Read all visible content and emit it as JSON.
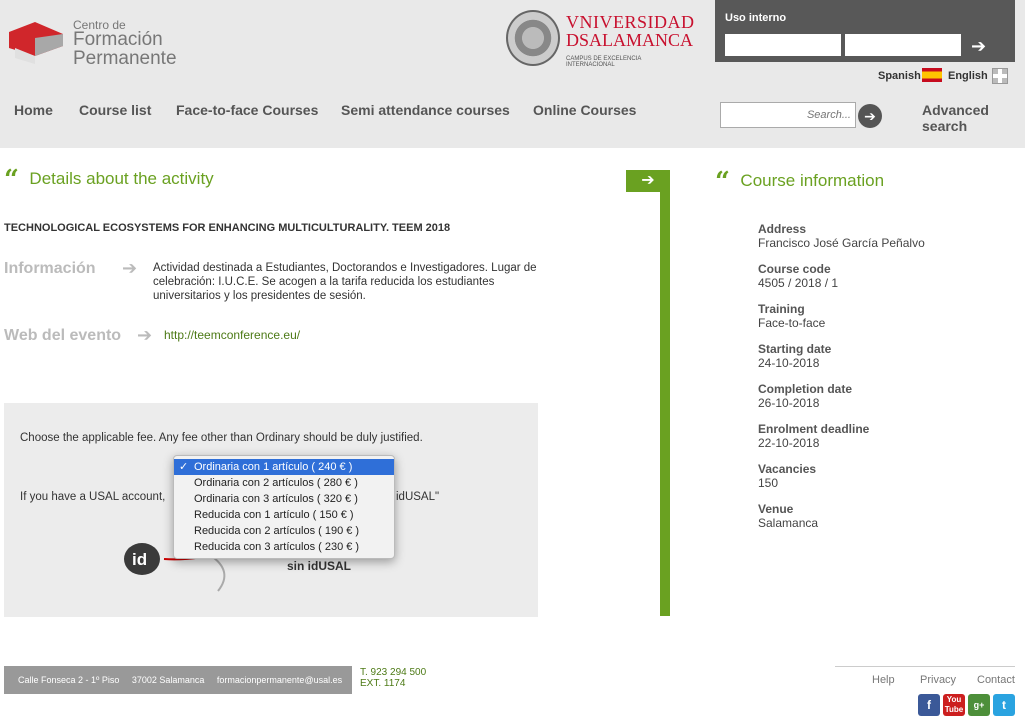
{
  "header": {
    "logo_cfp": {
      "line1": "Centro de",
      "line2": "Formación",
      "line3": "Permanente"
    },
    "logo_usal": {
      "line1": "VNIVERSIDAD",
      "line2": "DSALAMANCA",
      "line3": "CAMPUS DE EXCELENCIA INTERNACIONAL"
    },
    "uso_interno": "Uso interno",
    "lang_spanish": "Spanish",
    "lang_english": "English"
  },
  "nav": {
    "items": [
      "Home",
      "Course list",
      "Face-to-face Courses",
      "Semi attendance courses",
      "Online Courses"
    ],
    "search_placeholder": "Search...",
    "advanced_search": "Advanced search"
  },
  "details": {
    "heading": "Details about the activity",
    "activity_name": "TECHNOLOGICAL ECOSYSTEMS FOR ENHANCING MULTICULTURALITY. TEEM 2018",
    "info_label": "Información",
    "info_text": "Actividad destinada a Estudiantes, Doctorandos e Investigadores. Lugar de celebración: I.U.C.E. Se acogen a la tarifa reducida los estudiantes universitarios y los presidentes de sesión.",
    "web_label": "Web del evento",
    "web_link": "http://teemconference.eu/"
  },
  "fee": {
    "prompt": "Choose the applicable fee. Any fee other than Ordinary should be duly justified.",
    "usal_text_start": "If you have a USAL account,",
    "usal_text_end": "idUSAL\"",
    "sin_idusal": "sin idUSAL",
    "options": [
      "Ordinaria con 1 artículo ( 240 € )",
      "Ordinaria con 2 artículos ( 280 € )",
      "Ordinaria con 3 artículos ( 320 € )",
      "Reducida con 1 artículo ( 150 € )",
      "Reducida con 2 artículos ( 190 € )",
      "Reducida con 3 artículos ( 230 € )"
    ],
    "selected_index": 0
  },
  "course_info": {
    "heading": "Course information",
    "fields": [
      {
        "label": "Address",
        "value": "Francisco José García Peñalvo"
      },
      {
        "label": "Course code",
        "value": "4505 / 2018 / 1"
      },
      {
        "label": "Training",
        "value": "Face-to-face"
      },
      {
        "label": "Starting date",
        "value": "24-10-2018"
      },
      {
        "label": "Completion date",
        "value": "26-10-2018"
      },
      {
        "label": "Enrolment deadline",
        "value": "22-10-2018"
      },
      {
        "label": "Vacancies",
        "value": "150"
      },
      {
        "label": "Venue",
        "value": "Salamanca"
      }
    ]
  },
  "footer": {
    "address": "Calle Fonseca 2 - 1º Piso     37002 Salamanca     formacionpermanente@usal.es",
    "phone": "T. 923 294 500",
    "ext": "EXT. 1174",
    "links": [
      "Help",
      "Privacy",
      "Contact"
    ]
  },
  "colors": {
    "accent_green": "#6aa121",
    "select_blue": "#2f6fd8",
    "brand_red": "#c8102e"
  }
}
